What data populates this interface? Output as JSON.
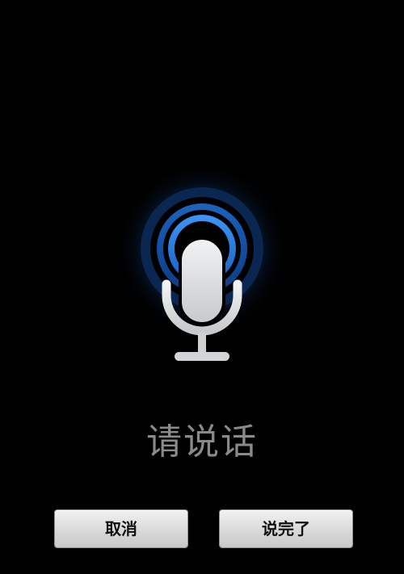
{
  "prompt": {
    "text": "请说话"
  },
  "buttons": {
    "cancel_label": "取消",
    "done_label": "说完了"
  },
  "icons": {
    "microphone": "microphone-icon",
    "pulse": "voice-pulse-rings"
  },
  "colors": {
    "background": "#000000",
    "ring_outer": "#0b2a55",
    "ring_middle": "#1456a8",
    "ring_inner": "#2f86ef",
    "microphone": "#d9dadc",
    "prompt_text": "#8a8a8a",
    "button_face": "#dcdcdc"
  }
}
